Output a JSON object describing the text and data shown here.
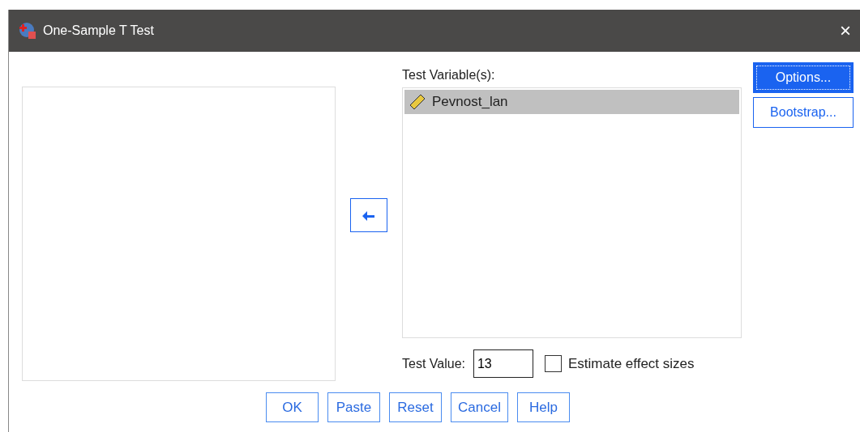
{
  "window": {
    "title": "One-Sample T Test",
    "close": "×"
  },
  "test_variables": {
    "label": "Test Variable(s):",
    "items": [
      {
        "name": "Pevnost_lan",
        "selected": true
      }
    ]
  },
  "side_buttons": [
    {
      "label": "Options...",
      "selected": true
    },
    {
      "label": "Bootstrap...",
      "selected": false
    }
  ],
  "test_value": {
    "label": "Test Value:",
    "value": "13"
  },
  "estimate_effect_sizes": {
    "label": "Estimate effect sizes",
    "checked": false
  },
  "buttons": [
    "OK",
    "Paste",
    "Reset",
    "Cancel",
    "Help"
  ]
}
